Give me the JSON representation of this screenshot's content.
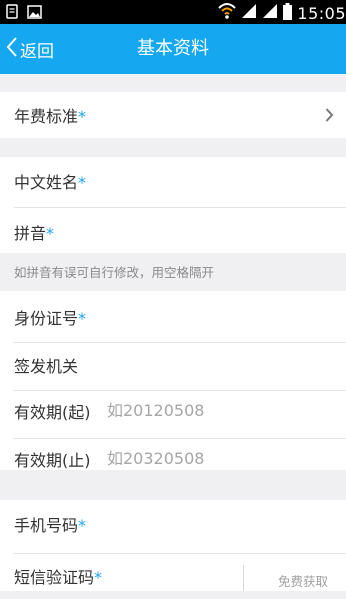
{
  "status_bar": {
    "time": "15:05",
    "icons": [
      "notification-icon",
      "image-icon",
      "wifi-icon",
      "signal-icon",
      "signal-icon",
      "battery-icon"
    ]
  },
  "header": {
    "back_label": "返回",
    "title": "基本资料",
    "background": "#15a8f1"
  },
  "required_mark": "*",
  "form": {
    "annual_fee": {
      "label": "年费标准"
    },
    "chinese_name": {
      "label": "中文姓名"
    },
    "pinyin": {
      "label": "拼音"
    },
    "pinyin_hint": "如拼音有误可自行修改，用空格隔开",
    "id_number": {
      "label": "身份证号"
    },
    "issuing_authority": {
      "label": "签发机关"
    },
    "valid_from": {
      "label": "有效期(起)",
      "placeholder": "如20120508"
    },
    "valid_to": {
      "label": "有效期(止)",
      "placeholder": "如20320508"
    },
    "mobile": {
      "label": "手机号码"
    },
    "sms_code": {
      "label": "短信验证码",
      "button_label": "免费获取"
    }
  },
  "colors": {
    "accent": "#15a8f1",
    "required": "#1aa7ee",
    "page_background": "#f0f0f3"
  }
}
